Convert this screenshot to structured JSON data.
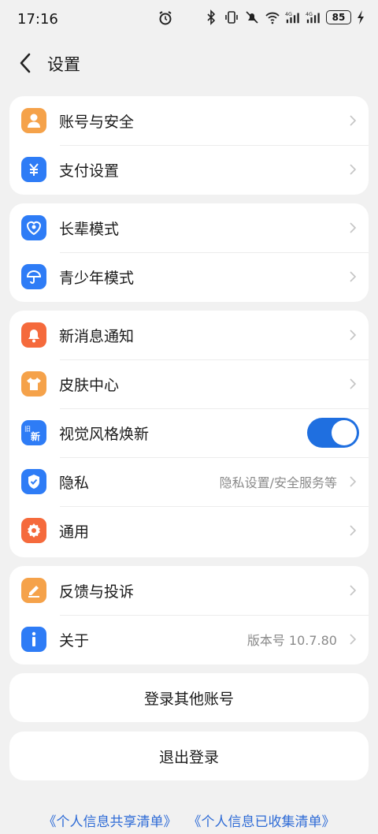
{
  "status_bar": {
    "time": "17:16",
    "battery": "85",
    "icons": [
      "alarm-icon",
      "bluetooth-icon",
      "vibrate-icon",
      "mute-icon",
      "wifi-icon",
      "signal-4g-icon",
      "signal-4g-icon",
      "charging-icon"
    ]
  },
  "nav": {
    "title": "设置"
  },
  "groups": [
    {
      "items": [
        {
          "label": "账号与安全",
          "icon": "account-icon",
          "color": "#f5a24a"
        },
        {
          "label": "支付设置",
          "icon": "payment-icon",
          "color": "#2e7cf6"
        }
      ]
    },
    {
      "items": [
        {
          "label": "长辈模式",
          "icon": "elder-mode-icon",
          "color": "#2e7cf6"
        },
        {
          "label": "青少年模式",
          "icon": "teen-mode-icon",
          "color": "#2e7cf6"
        }
      ]
    },
    {
      "items": [
        {
          "label": "新消息通知",
          "icon": "bell-icon",
          "color": "#f56a3c"
        },
        {
          "label": "皮肤中心",
          "icon": "tshirt-icon",
          "color": "#f5a24a"
        },
        {
          "label": "视觉风格焕新",
          "icon": "style-refresh-icon",
          "color": "#2e7cf6",
          "icon_text_small": "旧",
          "icon_text_big": "新",
          "toggle": true
        },
        {
          "label": "隐私",
          "icon": "privacy-shield-icon",
          "color": "#2e7cf6",
          "value": "隐私设置/安全服务等"
        },
        {
          "label": "通用",
          "icon": "gear-icon",
          "color": "#f56a3c"
        }
      ]
    },
    {
      "items": [
        {
          "label": "反馈与投诉",
          "icon": "feedback-icon",
          "color": "#f5a24a"
        },
        {
          "label": "关于",
          "icon": "info-icon",
          "color": "#2e7cf6",
          "value": "版本号 10.7.80"
        }
      ]
    }
  ],
  "actions": {
    "switch_account": "登录其他账号",
    "logout": "退出登录"
  },
  "footer": {
    "shared_list": "《个人信息共享清单》",
    "collected_list": "《个人信息已收集清单》"
  }
}
